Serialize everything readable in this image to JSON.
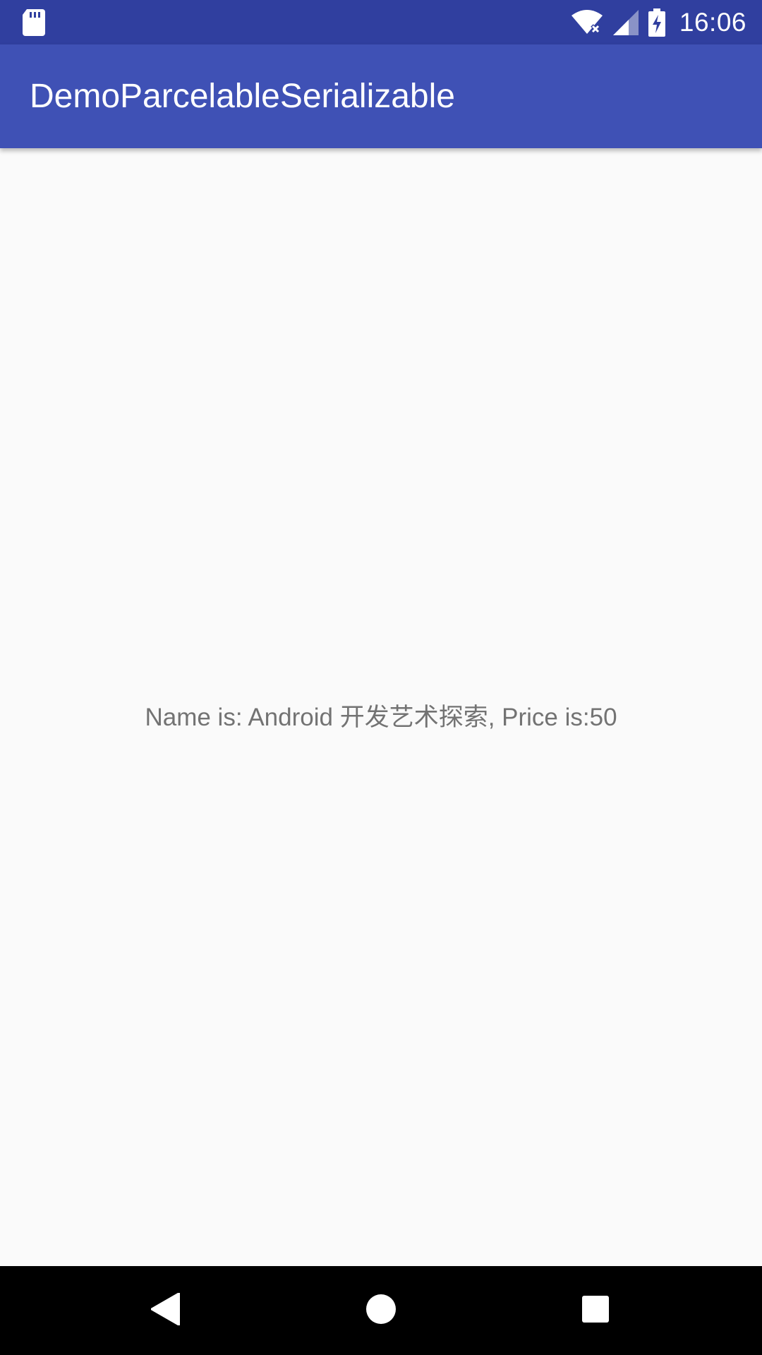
{
  "status_bar": {
    "time": "16:06",
    "icons": [
      "sd-card-icon",
      "wifi-icon",
      "signal-icon",
      "battery-charging-icon"
    ]
  },
  "app_bar": {
    "title": "DemoParcelableSerializable"
  },
  "content": {
    "message": "Name is: Android 开发艺术探索, Price is:50"
  },
  "nav_bar": {
    "icons": [
      "back-icon",
      "home-icon",
      "recents-icon"
    ]
  },
  "colors": {
    "status_bar": "#303f9f",
    "app_bar": "#3f51b5",
    "background": "#fafafa",
    "message_text": "#737373",
    "nav_bar": "#000000"
  }
}
